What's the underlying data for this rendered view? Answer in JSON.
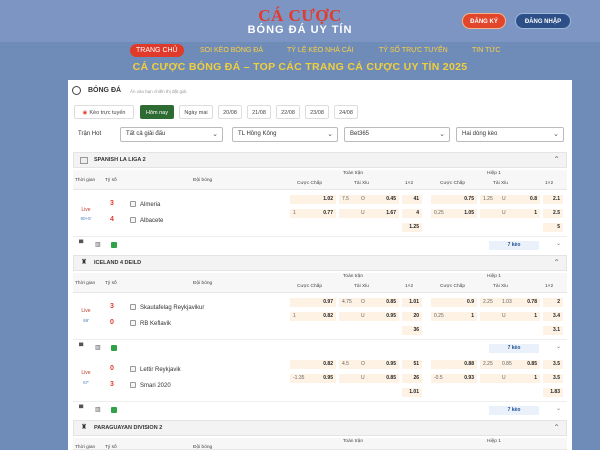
{
  "header": {
    "logo_line1": "CÁ CƯỢC",
    "logo_line2": "BÓNG ĐÁ UY TÍN",
    "register_label": "ĐĂNG KÝ",
    "login_label": "ĐĂNG NHẬP"
  },
  "nav": {
    "items": [
      "TRANG CHỦ",
      "SOI KÈO BÓNG ĐÁ",
      "TỶ LỆ KÈO NHÀ CÁI",
      "TỶ SỐ TRỰC TUYẾN",
      "TIN TỨC"
    ]
  },
  "headline": "CÁ CƯỢC BÓNG ĐÁ – TOP CÁC TRANG CÁ CƯỢC UY TÍN 2025",
  "panel": {
    "title": "BÓNG ĐÁ",
    "subtitle": "Ấn vào bạn chiến thị đặt giải",
    "chips": [
      "Kèo trực tuyến",
      "Hôm nay",
      "Ngày mai",
      "20/08",
      "21/08",
      "22/08",
      "23/08",
      "24/08"
    ],
    "filter_label": "Trận Hot",
    "selects": [
      "Tất cả giải đấu",
      "TL Hồng Kông",
      "Bet365",
      "Hai dòng kèo"
    ]
  },
  "table_headers": {
    "time": "Thời gian",
    "score": "Tỷ số",
    "teams": "Đội bóng",
    "full": "Toàn trận",
    "half": "Hiệp 1",
    "handicap": "Cược Chấp",
    "ou": "Tài Xỉu",
    "x12": "1×2"
  },
  "leagues": [
    {
      "name": "SPANISH LA LIGA 2",
      "more": "7 kèo",
      "matches": [
        {
          "status": "Live",
          "minute": "90+5'",
          "home": "Almeria",
          "away": "Albacete",
          "home_score": "3",
          "away_score": "4",
          "r1": [
            "1.02",
            "7.5",
            "O",
            "0.45",
            "41",
            "0.75",
            "1.25",
            "U",
            "0.8",
            "2.1"
          ],
          "r2": [
            "1",
            "0.77",
            "U",
            "1.67",
            "4",
            "0.25",
            "1.05",
            "U",
            "1",
            "2.5"
          ],
          "r3": [
            "1.25",
            "5"
          ]
        }
      ]
    },
    {
      "name": "ICELAND 4 DEILD",
      "more": "7 kèo",
      "matches": [
        {
          "status": "Live",
          "minute": "69'",
          "home": "Skautafelag Reykjavikur",
          "away": "RB Keflavik",
          "home_score": "3",
          "away_score": "0",
          "r1": [
            "0.97",
            "4.75",
            "O",
            "0.85",
            "1.01",
            "0.9",
            "2.25",
            "1.03",
            "0.78",
            "2"
          ],
          "r2": [
            "1",
            "0.82",
            "U",
            "0.95",
            "20",
            "0.25",
            "1",
            "U",
            "1",
            "3.4"
          ],
          "r3": [
            "36",
            "3.1"
          ]
        },
        {
          "status": "Live",
          "minute": "67'",
          "home": "Lettir Reykjavik",
          "away": "Smari 2020",
          "home_score": "0",
          "away_score": "3",
          "r1": [
            "0.82",
            "4.5",
            "O",
            "0.95",
            "51",
            "0.88",
            "2.25",
            "0.85",
            "0.85",
            "3.5"
          ],
          "r2": [
            "-1.35",
            "0.95",
            "U",
            "0.85",
            "26",
            "-0.5",
            "0.93",
            "U",
            "1",
            "3.5"
          ],
          "r3": [
            "1.01",
            "1.83"
          ]
        }
      ]
    },
    {
      "name": "PARAGUAYAN DIVISION 2"
    }
  ],
  "colors": {
    "accent": "#e23b2e",
    "nav_text": "#ffcf3c",
    "header_bg": "#7c95c2",
    "active_chip": "#2e6b33"
  }
}
